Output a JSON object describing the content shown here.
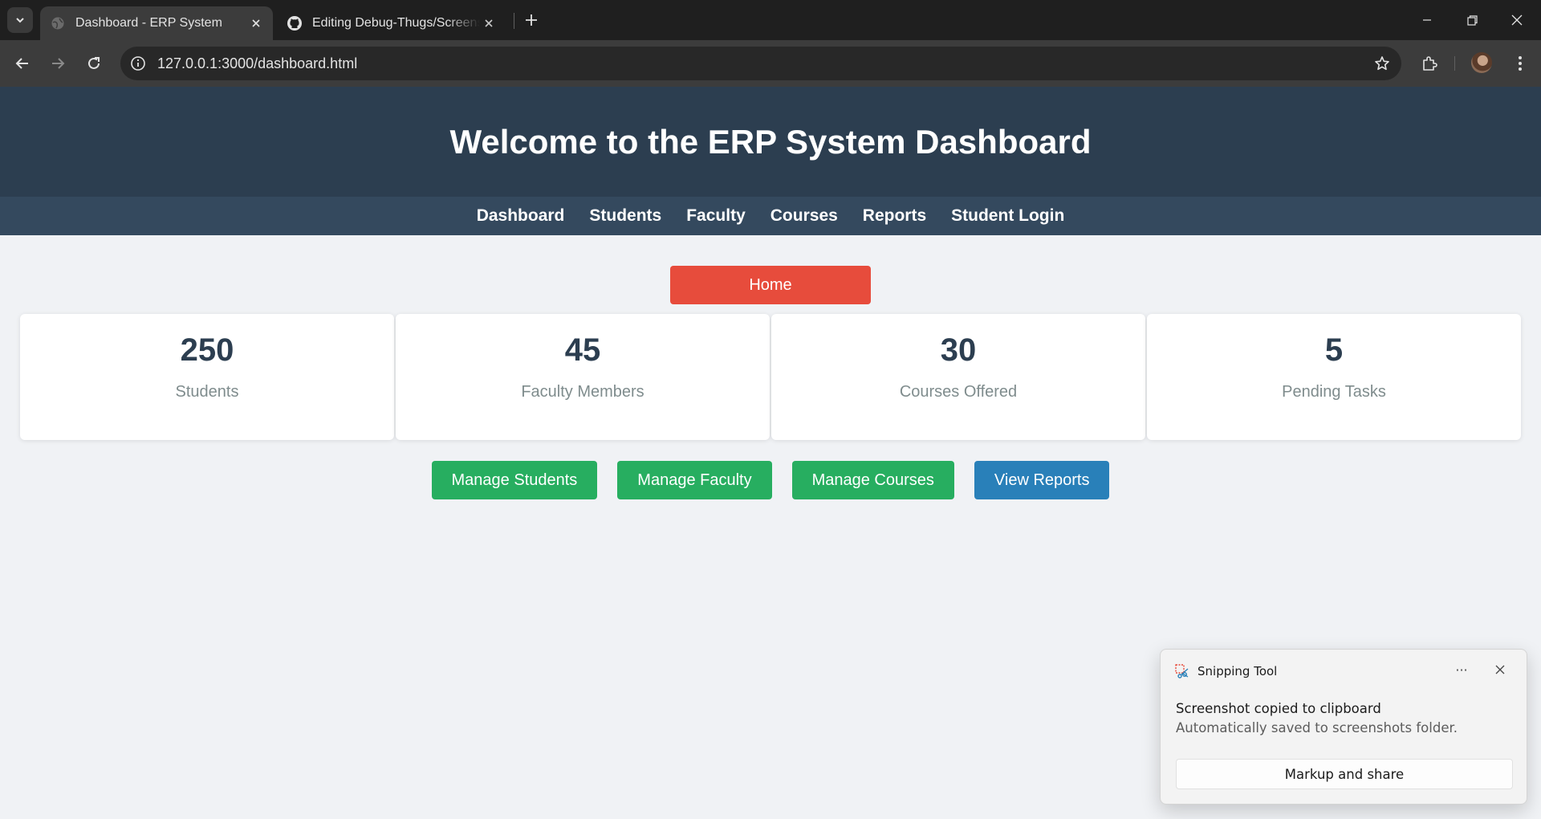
{
  "browser": {
    "tabs": [
      {
        "title": "Dashboard - ERP System",
        "active": true,
        "favicon": "globe-icon"
      },
      {
        "title": "Editing Debug-Thugs/Screenshots",
        "active": false,
        "favicon": "github-icon"
      }
    ],
    "url": "127.0.0.1:3000/dashboard.html"
  },
  "header": {
    "title": "Welcome to the ERP System Dashboard"
  },
  "nav": {
    "items": [
      "Dashboard",
      "Students",
      "Faculty",
      "Courses",
      "Reports",
      "Student Login"
    ]
  },
  "home_button": "Home",
  "stats": [
    {
      "value": "250",
      "label": "Students"
    },
    {
      "value": "45",
      "label": "Faculty Members"
    },
    {
      "value": "30",
      "label": "Courses Offered"
    },
    {
      "value": "5",
      "label": "Pending Tasks"
    }
  ],
  "actions": [
    "Manage Students",
    "Manage Faculty",
    "Manage Courses",
    "View Reports"
  ],
  "colors": {
    "header_bg": "#2c3e50",
    "nav_bg": "#34495e",
    "home_button": "#e74c3c",
    "action_green": "#27ae60",
    "action_blue": "#2980b9"
  },
  "toast": {
    "app": "Snipping Tool",
    "more": "···",
    "title": "Screenshot copied to clipboard",
    "subtitle": "Automatically saved to screenshots folder.",
    "button": "Markup and share"
  }
}
